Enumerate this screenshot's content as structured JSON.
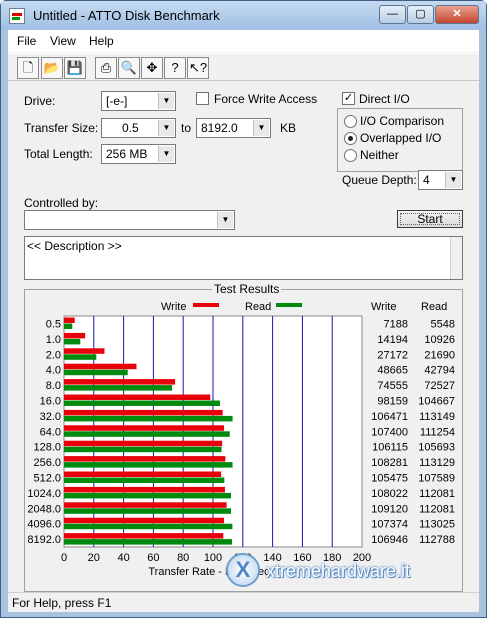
{
  "window": {
    "title": "Untitled - ATTO Disk Benchmark"
  },
  "menu": [
    "File",
    "View",
    "Help"
  ],
  "toolbar": [
    "new-icon",
    "open-icon",
    "save-icon",
    "print-icon",
    "print-preview-icon",
    "move-icon",
    "help-icon",
    "context-help-icon"
  ],
  "form": {
    "drive_label": "Drive:",
    "drive_value": "[-e-]",
    "force_write_label": "Force Write Access",
    "direct_io_label": "Direct I/O",
    "transfer_size_label": "Transfer Size:",
    "transfer_min": "0.5",
    "to_label": "to",
    "transfer_max": "8192.0",
    "kb_label": "KB",
    "total_length_label": "Total Length:",
    "total_length_value": "256 MB",
    "io_comparison_label": "I/O Comparison",
    "overlapped_io_label": "Overlapped I/O",
    "neither_label": "Neither",
    "queue_depth_label": "Queue Depth:",
    "queue_depth_value": "4",
    "controlled_by_label": "Controlled by:",
    "controlled_by_value": "",
    "start_label": "Start",
    "description_text": "<< Description >>"
  },
  "results": {
    "group_title": "Test Results",
    "write_legend": "Write",
    "read_legend": "Read",
    "write_header": "Write",
    "read_header": "Read"
  },
  "chart_data": {
    "type": "bar",
    "orientation": "horizontal",
    "categories": [
      "0.5",
      "1.0",
      "2.0",
      "4.0",
      "8.0",
      "16.0",
      "32.0",
      "64.0",
      "128.0",
      "256.0",
      "512.0",
      "1024.0",
      "2048.0",
      "4096.0",
      "8192.0"
    ],
    "series": [
      {
        "name": "Write",
        "color": "#e8000b",
        "values": [
          7188,
          14194,
          27172,
          48665,
          74555,
          98159,
          106471,
          107400,
          106115,
          108281,
          105475,
          108022,
          109120,
          107374,
          106946
        ]
      },
      {
        "name": "Read",
        "color": "#008a0e",
        "values": [
          5548,
          10926,
          21690,
          42794,
          72527,
          104667,
          113149,
          111254,
          105693,
          113129,
          107589,
          112081,
          112081,
          113025,
          112788
        ]
      }
    ],
    "xlabel": "Transfer Rate - MB / Sec",
    "xticks": [
      "0",
      "20",
      "40",
      "60",
      "80",
      "100",
      "120",
      "140",
      "160",
      "180",
      "200"
    ],
    "xlim": [
      0,
      200
    ]
  },
  "status": {
    "text": "For Help, press F1"
  },
  "watermark": {
    "text": "xtremehardware.it"
  }
}
